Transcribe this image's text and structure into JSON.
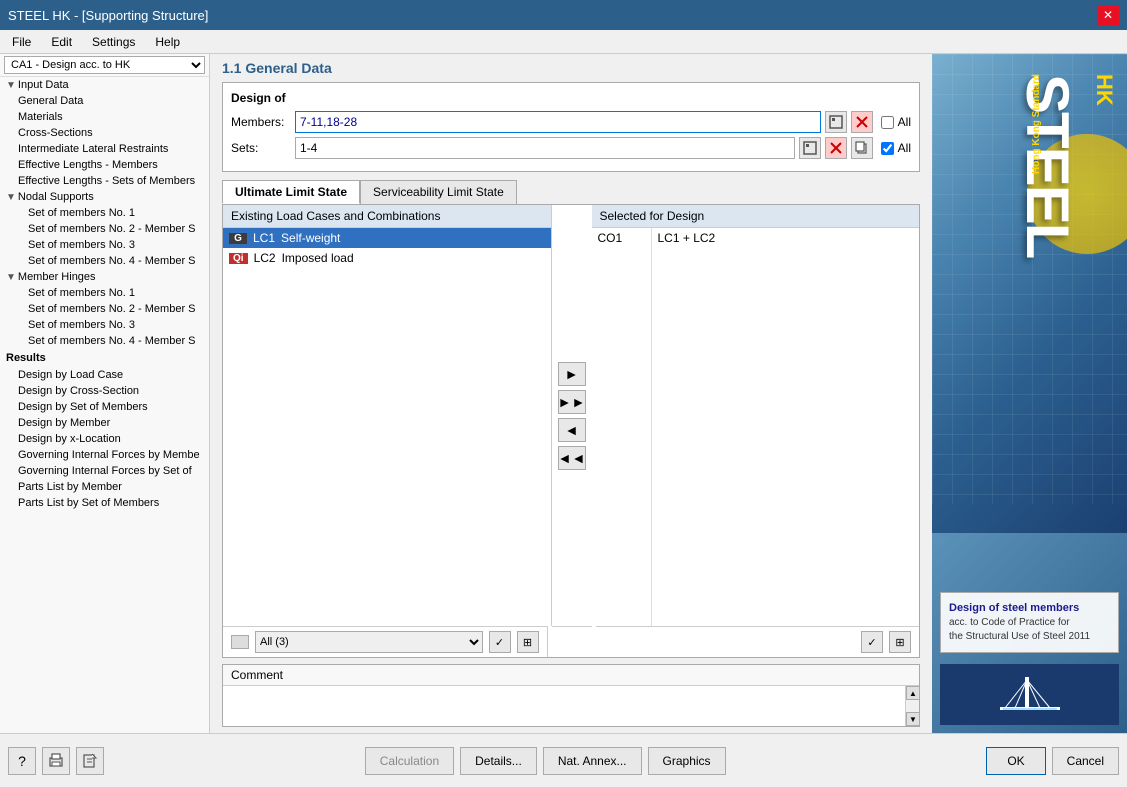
{
  "app": {
    "title": "STEEL HK - [Supporting Structure]",
    "close_btn": "✕"
  },
  "menu": {
    "items": [
      "File",
      "Edit",
      "Settings",
      "Help"
    ]
  },
  "sidebar": {
    "dropdown_value": "CA1 - Design acc. to HK",
    "sections": [
      {
        "label": "Input Data",
        "type": "section"
      },
      {
        "label": "General Data",
        "type": "child"
      },
      {
        "label": "Materials",
        "type": "child"
      },
      {
        "label": "Cross-Sections",
        "type": "child"
      },
      {
        "label": "Intermediate Lateral Restraints",
        "type": "child"
      },
      {
        "label": "Effective Lengths - Members",
        "type": "child"
      },
      {
        "label": "Effective Lengths - Sets of Members",
        "type": "child"
      },
      {
        "label": "Nodal Supports",
        "type": "section"
      },
      {
        "label": "Set of members No. 1",
        "type": "child2"
      },
      {
        "label": "Set of members No. 2 - Member S",
        "type": "child2"
      },
      {
        "label": "Set of members No. 3",
        "type": "child2"
      },
      {
        "label": "Set of members No. 4 - Member S",
        "type": "child2"
      },
      {
        "label": "Member Hinges",
        "type": "section"
      },
      {
        "label": "Set of members No. 1",
        "type": "child2"
      },
      {
        "label": "Set of members No. 2 - Member S",
        "type": "child2"
      },
      {
        "label": "Set of members No. 3",
        "type": "child2"
      },
      {
        "label": "Set of members No. 4 - Member S",
        "type": "child2"
      },
      {
        "label": "Results",
        "type": "results"
      },
      {
        "label": "Design by Load Case",
        "type": "child"
      },
      {
        "label": "Design by Cross-Section",
        "type": "child"
      },
      {
        "label": "Design by Set of Members",
        "type": "child"
      },
      {
        "label": "Design by Member",
        "type": "child"
      },
      {
        "label": "Design by x-Location",
        "type": "child"
      },
      {
        "label": "Governing Internal Forces by Member",
        "type": "child"
      },
      {
        "label": "Governing Internal Forces by Set of",
        "type": "child"
      },
      {
        "label": "Parts List by Member",
        "type": "child"
      },
      {
        "label": "Parts List by Set of Members",
        "type": "child"
      }
    ]
  },
  "content": {
    "section_title": "1.1 General Data",
    "design_of_label": "Design of",
    "members_label": "Members:",
    "members_value": "7-11,18-28",
    "sets_label": "Sets:",
    "sets_value": "1-4",
    "all_checkbox1": "All",
    "all_checkbox2": "All",
    "all_checked1": false,
    "all_checked2": true
  },
  "tabs": [
    {
      "label": "Ultimate Limit State",
      "active": true
    },
    {
      "label": "Serviceability Limit State",
      "active": false
    }
  ],
  "load_cases": {
    "existing_header": "Existing Load Cases and Combinations",
    "selected_header": "Selected for Design",
    "items": [
      {
        "badge": "G",
        "badge_type": "g",
        "id": "LC1",
        "name": "Self-weight",
        "selected": true
      },
      {
        "badge": "Qi",
        "badge_type": "q",
        "id": "LC2",
        "name": "Imposed load",
        "selected": false
      }
    ],
    "selected_items": [
      {
        "co": "CO1",
        "lc": "LC1 + LC2"
      }
    ],
    "dropdown_value": "All (3)",
    "arrow_right": "▶",
    "arrow_right_all": "▶▶",
    "arrow_left": "◀",
    "arrow_left_all": "◀◀"
  },
  "comment": {
    "label": "Comment",
    "value": ""
  },
  "bottom_toolbar": {
    "icons": [
      "?",
      "📄",
      "📤"
    ],
    "calculation_btn": "Calculation",
    "details_btn": "Details...",
    "nat_annex_btn": "Nat. Annex...",
    "graphics_btn": "Graphics",
    "ok_btn": "OK",
    "cancel_btn": "Cancel"
  },
  "branding": {
    "steel": "STEEL",
    "hk": "HK",
    "hong_kong_standard": "Hong Kong Standard",
    "description_line1": "Design of steel members",
    "description_line2": "acc. to Code of Practice for",
    "description_line3": "the Structural Use of Steel 2011"
  }
}
